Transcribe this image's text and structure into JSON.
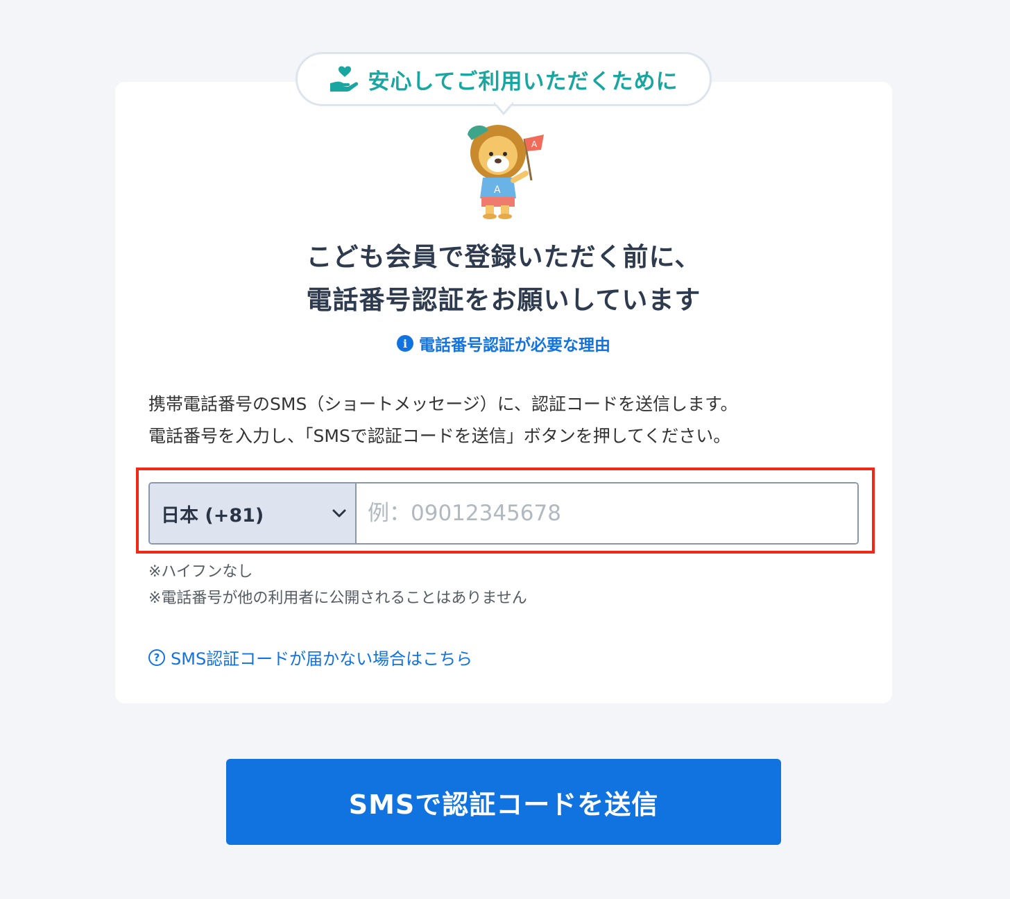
{
  "badge": {
    "text": "安心してご利用いただくために",
    "icon": "heart-hand-icon"
  },
  "headline": {
    "line1": "こども会員で登録いただく前に、",
    "line2": "電話番号認証をお願いしています"
  },
  "reason_link": {
    "icon": "info-icon",
    "label": "電話番号認証が必要な理由"
  },
  "instructions": {
    "line1": "携帯電話番号のSMS（ショートメッセージ）に、認証コードを送信します。",
    "line2": "電話番号を入力し、「SMSで認証コードを送信」ボタンを押してください。"
  },
  "phone": {
    "country_selected": "日本 (+81)",
    "placeholder": "例：09012345678",
    "value": ""
  },
  "notes": {
    "no_hyphen": "※ハイフンなし",
    "privacy": "※電話番号が他の利用者に公開されることはありません"
  },
  "help_link": {
    "icon": "question-circle-icon",
    "label": "SMS認証コードが届かない場合はこちら"
  },
  "submit": {
    "label": "SMSで認証コードを送信"
  },
  "colors": {
    "accent_teal": "#1aa6a0",
    "link_blue": "#1173e0",
    "highlight_red": "#ee2a16",
    "background": "#f3f5f9"
  }
}
